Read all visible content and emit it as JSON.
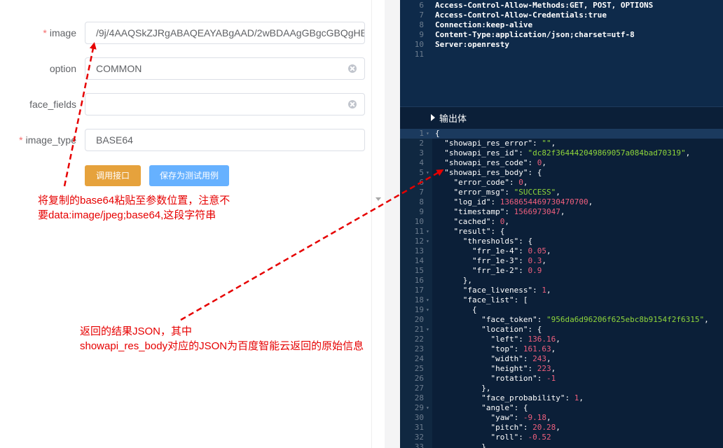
{
  "form": {
    "fields": [
      {
        "label": "image",
        "required": true,
        "value": "/9j/4AAQSkZJRgABAQEAYABgAAD/2wBDAAgGBgcGBQgHBw",
        "clearable": false
      },
      {
        "label": "option",
        "required": false,
        "value": "COMMON",
        "clearable": true
      },
      {
        "label": "face_fields",
        "required": false,
        "value": "",
        "clearable": true
      },
      {
        "label": "image_type",
        "required": true,
        "value": "BASE64",
        "clearable": false
      }
    ],
    "buttons": {
      "call": "调用接口",
      "save": "保存为测试用例"
    },
    "colors": {
      "call": "#e6a23c",
      "save": "#66b1ff",
      "required_star": "#f56c6c"
    }
  },
  "annotations": {
    "first_line1": "将复制的base64粘贴至参数位置，注意不",
    "first_line2": "要data:image/jpeg;base64,这段字符串",
    "second_line1": "返回的结果JSON，其中",
    "second_line2": "showapi_res_body对应的JSON为百度智能云返回的原始信息",
    "color": "#e60000"
  },
  "headers": {
    "lines": [
      {
        "n": "6",
        "text": "Access-Control-Allow-Methods:GET, POST, OPTIONS"
      },
      {
        "n": "7",
        "text": "Access-Control-Allow-Credentials:true"
      },
      {
        "n": "8",
        "text": "Connection:keep-alive"
      },
      {
        "n": "9",
        "text": "Content-Type:application/json;charset=utf-8"
      },
      {
        "n": "10",
        "text": "Server:openresty"
      },
      {
        "n": "11",
        "text": ""
      }
    ]
  },
  "output": {
    "title": "输出体",
    "json_lines": [
      {
        "n": "1",
        "fold": true,
        "tokens": [
          [
            "p",
            "{"
          ]
        ]
      },
      {
        "n": "2",
        "tokens": [
          [
            "p",
            "  "
          ],
          [
            "k",
            "\"showapi_res_error\""
          ],
          [
            "p",
            ": "
          ],
          [
            "s",
            "\"\""
          ],
          [
            "p",
            ","
          ]
        ]
      },
      {
        "n": "3",
        "tokens": [
          [
            "p",
            "  "
          ],
          [
            "k",
            "\"showapi_res_id\""
          ],
          [
            "p",
            ": "
          ],
          [
            "s",
            "\"dc82f364442049869057a084bad70319\""
          ],
          [
            "p",
            ","
          ]
        ]
      },
      {
        "n": "4",
        "tokens": [
          [
            "p",
            "  "
          ],
          [
            "k",
            "\"showapi_res_code\""
          ],
          [
            "p",
            ": "
          ],
          [
            "n",
            "0"
          ],
          [
            "p",
            ","
          ]
        ]
      },
      {
        "n": "5",
        "fold": true,
        "tokens": [
          [
            "p",
            "  "
          ],
          [
            "k",
            "\"showapi_res_body\""
          ],
          [
            "p",
            ": {"
          ]
        ]
      },
      {
        "n": "6",
        "tokens": [
          [
            "p",
            "    "
          ],
          [
            "k",
            "\"error_code\""
          ],
          [
            "p",
            ": "
          ],
          [
            "n",
            "0"
          ],
          [
            "p",
            ","
          ]
        ]
      },
      {
        "n": "7",
        "tokens": [
          [
            "p",
            "    "
          ],
          [
            "k",
            "\"error_msg\""
          ],
          [
            "p",
            ": "
          ],
          [
            "s",
            "\"SUCCESS\""
          ],
          [
            "p",
            ","
          ]
        ]
      },
      {
        "n": "8",
        "tokens": [
          [
            "p",
            "    "
          ],
          [
            "k",
            "\"log_id\""
          ],
          [
            "p",
            ": "
          ],
          [
            "n",
            "1368654469730470700"
          ],
          [
            "p",
            ","
          ]
        ]
      },
      {
        "n": "9",
        "tokens": [
          [
            "p",
            "    "
          ],
          [
            "k",
            "\"timestamp\""
          ],
          [
            "p",
            ": "
          ],
          [
            "n",
            "1566973047"
          ],
          [
            "p",
            ","
          ]
        ]
      },
      {
        "n": "10",
        "tokens": [
          [
            "p",
            "    "
          ],
          [
            "k",
            "\"cached\""
          ],
          [
            "p",
            ": "
          ],
          [
            "n",
            "0"
          ],
          [
            "p",
            ","
          ]
        ]
      },
      {
        "n": "11",
        "fold": true,
        "tokens": [
          [
            "p",
            "    "
          ],
          [
            "k",
            "\"result\""
          ],
          [
            "p",
            ": {"
          ]
        ]
      },
      {
        "n": "12",
        "fold": true,
        "tokens": [
          [
            "p",
            "      "
          ],
          [
            "k",
            "\"thresholds\""
          ],
          [
            "p",
            ": {"
          ]
        ]
      },
      {
        "n": "13",
        "tokens": [
          [
            "p",
            "        "
          ],
          [
            "k",
            "\"frr_1e-4\""
          ],
          [
            "p",
            ": "
          ],
          [
            "n",
            "0.05"
          ],
          [
            "p",
            ","
          ]
        ]
      },
      {
        "n": "14",
        "tokens": [
          [
            "p",
            "        "
          ],
          [
            "k",
            "\"frr_1e-3\""
          ],
          [
            "p",
            ": "
          ],
          [
            "n",
            "0.3"
          ],
          [
            "p",
            ","
          ]
        ]
      },
      {
        "n": "15",
        "tokens": [
          [
            "p",
            "        "
          ],
          [
            "k",
            "\"frr_1e-2\""
          ],
          [
            "p",
            ": "
          ],
          [
            "n",
            "0.9"
          ]
        ]
      },
      {
        "n": "16",
        "tokens": [
          [
            "p",
            "      },"
          ]
        ]
      },
      {
        "n": "17",
        "tokens": [
          [
            "p",
            "      "
          ],
          [
            "k",
            "\"face_liveness\""
          ],
          [
            "p",
            ": "
          ],
          [
            "n",
            "1"
          ],
          [
            "p",
            ","
          ]
        ]
      },
      {
        "n": "18",
        "fold": true,
        "tokens": [
          [
            "p",
            "      "
          ],
          [
            "k",
            "\"face_list\""
          ],
          [
            "p",
            ": ["
          ]
        ]
      },
      {
        "n": "19",
        "fold": true,
        "tokens": [
          [
            "p",
            "        {"
          ]
        ]
      },
      {
        "n": "20",
        "tokens": [
          [
            "p",
            "          "
          ],
          [
            "k",
            "\"face_token\""
          ],
          [
            "p",
            ": "
          ],
          [
            "s",
            "\"956da6d96206f625ebc8b9154f2f6315\""
          ],
          [
            "p",
            ","
          ]
        ]
      },
      {
        "n": "21",
        "fold": true,
        "tokens": [
          [
            "p",
            "          "
          ],
          [
            "k",
            "\"location\""
          ],
          [
            "p",
            ": {"
          ]
        ]
      },
      {
        "n": "22",
        "tokens": [
          [
            "p",
            "            "
          ],
          [
            "k",
            "\"left\""
          ],
          [
            "p",
            ": "
          ],
          [
            "n",
            "136.16"
          ],
          [
            "p",
            ","
          ]
        ]
      },
      {
        "n": "23",
        "tokens": [
          [
            "p",
            "            "
          ],
          [
            "k",
            "\"top\""
          ],
          [
            "p",
            ": "
          ],
          [
            "n",
            "161.63"
          ],
          [
            "p",
            ","
          ]
        ]
      },
      {
        "n": "24",
        "tokens": [
          [
            "p",
            "            "
          ],
          [
            "k",
            "\"width\""
          ],
          [
            "p",
            ": "
          ],
          [
            "n",
            "243"
          ],
          [
            "p",
            ","
          ]
        ]
      },
      {
        "n": "25",
        "tokens": [
          [
            "p",
            "            "
          ],
          [
            "k",
            "\"height\""
          ],
          [
            "p",
            ": "
          ],
          [
            "n",
            "223"
          ],
          [
            "p",
            ","
          ]
        ]
      },
      {
        "n": "26",
        "tokens": [
          [
            "p",
            "            "
          ],
          [
            "k",
            "\"rotation\""
          ],
          [
            "p",
            ": "
          ],
          [
            "n",
            "-1"
          ]
        ]
      },
      {
        "n": "27",
        "tokens": [
          [
            "p",
            "          },"
          ]
        ]
      },
      {
        "n": "28",
        "tokens": [
          [
            "p",
            "          "
          ],
          [
            "k",
            "\"face_probability\""
          ],
          [
            "p",
            ": "
          ],
          [
            "n",
            "1"
          ],
          [
            "p",
            ","
          ]
        ]
      },
      {
        "n": "29",
        "fold": true,
        "tokens": [
          [
            "p",
            "          "
          ],
          [
            "k",
            "\"angle\""
          ],
          [
            "p",
            ": {"
          ]
        ]
      },
      {
        "n": "30",
        "tokens": [
          [
            "p",
            "            "
          ],
          [
            "k",
            "\"yaw\""
          ],
          [
            "p",
            ": "
          ],
          [
            "n",
            "-9.18"
          ],
          [
            "p",
            ","
          ]
        ]
      },
      {
        "n": "31",
        "tokens": [
          [
            "p",
            "            "
          ],
          [
            "k",
            "\"pitch\""
          ],
          [
            "p",
            ": "
          ],
          [
            "n",
            "20.28"
          ],
          [
            "p",
            ","
          ]
        ]
      },
      {
        "n": "32",
        "tokens": [
          [
            "p",
            "            "
          ],
          [
            "k",
            "\"roll\""
          ],
          [
            "p",
            ": "
          ],
          [
            "n",
            "-0.52"
          ]
        ]
      },
      {
        "n": "33",
        "tokens": [
          [
            "p",
            "          }"
          ]
        ]
      }
    ],
    "colors": {
      "string": "#8fd63b",
      "number": "#ef5f7d",
      "key": "#ffffff",
      "background": "#0b1f38"
    }
  }
}
